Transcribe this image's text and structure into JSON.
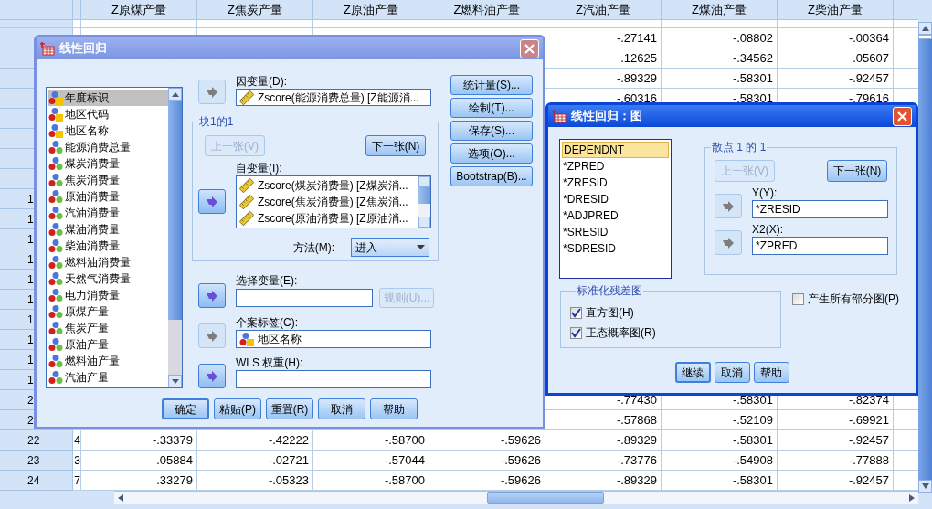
{
  "grid": {
    "columns": [
      {
        "heading": "Z原煤产量"
      },
      {
        "heading": "Z焦炭产量"
      },
      {
        "heading": "Z原油产量"
      },
      {
        "heading": "Z燃料油产量"
      },
      {
        "heading": "Z汽油产量"
      },
      {
        "heading": "Z煤油产量"
      },
      {
        "heading": "Z柴油产量"
      }
    ],
    "rows": [
      {
        "cells": [
          null,
          null,
          null,
          null,
          "-.27141",
          "-.08802",
          "-.00364"
        ]
      },
      {
        "cells": [
          null,
          null,
          null,
          null,
          ".12625",
          "-.34562",
          ".05607"
        ]
      },
      {
        "cells": [
          null,
          null,
          null,
          null,
          "-.89329",
          "-.58301",
          "-.92457"
        ]
      },
      {
        "cells": [
          null,
          null,
          null,
          null,
          "-.60316",
          "-.58301",
          "-.79616"
        ]
      },
      {},
      {},
      {},
      {},
      {
        "label": "1"
      },
      {
        "label": "1"
      },
      {
        "label": "1"
      },
      {
        "label": "1"
      },
      {
        "label": "1"
      },
      {
        "label": "1"
      },
      {
        "label": "1"
      },
      {
        "label": "1"
      },
      {
        "label": "1"
      },
      {
        "label": "1"
      },
      {
        "label": "2",
        "cells": [
          null,
          null,
          null,
          null,
          "-.77430",
          "-.58301",
          "-.82374"
        ]
      },
      {
        "label": "2",
        "cells": [
          null,
          null,
          null,
          null,
          "-.57868",
          "-.52109",
          "-.69921"
        ]
      },
      {
        "label": "22",
        "cut_value": "4",
        "cells": [
          "-.33379",
          "-.42222",
          "-.58700",
          "-.59626",
          "-.89329",
          "-.58301",
          "-.92457"
        ]
      },
      {
        "label": "23",
        "cut_value": "3",
        "cells": [
          ".05884",
          "-.02721",
          "-.57044",
          "-.59626",
          "-.73776",
          "-.54908",
          "-.77888"
        ]
      },
      {
        "label": "24",
        "cut_value": "7",
        "cells": [
          ".33279",
          "-.05323",
          "-.58700",
          "-.59626",
          "-.89329",
          "-.58301",
          "-.92457"
        ]
      }
    ]
  },
  "regression_dialog": {
    "title": "线性回归",
    "active": false,
    "variables": [
      {
        "name": "年度标识",
        "kind": "string",
        "selected": true
      },
      {
        "name": "地区代码",
        "kind": "string",
        "selected": false
      },
      {
        "name": "地区名称",
        "kind": "string",
        "selected": false
      },
      {
        "name": "能源消费总量",
        "kind": "scale",
        "selected": false
      },
      {
        "name": "煤炭消费量",
        "kind": "scale",
        "selected": false
      },
      {
        "name": "焦炭消费量",
        "kind": "scale",
        "selected": false
      },
      {
        "name": "原油消费量",
        "kind": "scale",
        "selected": false
      },
      {
        "name": "汽油消费量",
        "kind": "scale",
        "selected": false
      },
      {
        "name": "煤油消费量",
        "kind": "scale",
        "selected": false
      },
      {
        "name": "柴油消费量",
        "kind": "scale",
        "selected": false
      },
      {
        "name": "燃料油消费量",
        "kind": "scale",
        "selected": false
      },
      {
        "name": "天然气消费量",
        "kind": "scale",
        "selected": false
      },
      {
        "name": "电力消费量",
        "kind": "scale",
        "selected": false
      },
      {
        "name": "原煤产量",
        "kind": "scale",
        "selected": false
      },
      {
        "name": "焦炭产量",
        "kind": "scale",
        "selected": false
      },
      {
        "name": "原油产量",
        "kind": "scale",
        "selected": false
      },
      {
        "name": "燃料油产量",
        "kind": "scale",
        "selected": false
      },
      {
        "name": "汽油产量",
        "kind": "scale",
        "selected": false
      }
    ],
    "dependent": {
      "label": "因变量(D):",
      "value": "Zscore(能源消费总量) [Z能源消...",
      "arrow_disabled": true
    },
    "block": {
      "title": "块1的1",
      "previous": {
        "label": "上一张(V)",
        "disabled": true
      },
      "next": {
        "label": "下一张(N)",
        "disabled": false
      },
      "arrow_disabled": false,
      "independents_label": "自变量(I):",
      "independents": [
        "Zscore(煤炭消费量) [Z煤炭消...",
        "Zscore(焦炭消费量) [Z焦炭消...",
        "Zscore(原油消费量) [Z原油消..."
      ],
      "method_label": "方法(M):",
      "method": "进入"
    },
    "selection": {
      "label": "选择变量(E):",
      "arrow_disabled": false,
      "rule": {
        "label": "规则(U)...",
        "disabled": true
      }
    },
    "case_label": {
      "label": "个案标签(C):",
      "value": "地区名称",
      "kind": "string",
      "arrow_disabled": true
    },
    "wls": {
      "label": "WLS 权重(H):",
      "arrow_disabled": false
    },
    "side_buttons": [
      "统计量(S)...",
      "绘制(T)...",
      "保存(S)...",
      "选项(O)...",
      "Bootstrap(B)..."
    ],
    "buttons": [
      {
        "label": "确定",
        "default": true
      },
      {
        "label": "粘贴(P)",
        "default": false
      },
      {
        "label": "重置(R)",
        "default": false
      },
      {
        "label": "取消",
        "default": false
      },
      {
        "label": "帮助",
        "default": false
      }
    ]
  },
  "plots_dialog": {
    "title": "线性回归：图",
    "active": true,
    "items": [
      {
        "name": "DEPENDNT",
        "selected": true
      },
      {
        "name": "*ZPRED",
        "selected": false
      },
      {
        "name": "*ZRESID",
        "selected": false
      },
      {
        "name": "*DRESID",
        "selected": false
      },
      {
        "name": "*ADJPRED",
        "selected": false
      },
      {
        "name": "*SRESID",
        "selected": false
      },
      {
        "name": "*SDRESID",
        "selected": false
      }
    ],
    "scatter": {
      "title": "散点 1 的 1",
      "previous": {
        "label": "上一张(V)",
        "disabled": true
      },
      "next": {
        "label": "下一张(N)",
        "disabled": false
      },
      "y": {
        "label": "Y(Y):",
        "value": "*ZRESID",
        "arrow_disabled": true
      },
      "x": {
        "label": "X2(X):",
        "value": "*ZPRED",
        "arrow_disabled": true
      }
    },
    "standardized": {
      "title": "标准化残差图",
      "options": [
        {
          "label": "直方图(H)",
          "checked": true
        },
        {
          "label": "正态概率图(R)",
          "checked": true
        }
      ]
    },
    "partial_plots": {
      "label": "产生所有部分图(P)",
      "checked": false
    },
    "buttons": [
      {
        "label": "继续",
        "default": true
      },
      {
        "label": "取消",
        "default": false
      },
      {
        "label": "帮助",
        "default": false
      }
    ]
  }
}
